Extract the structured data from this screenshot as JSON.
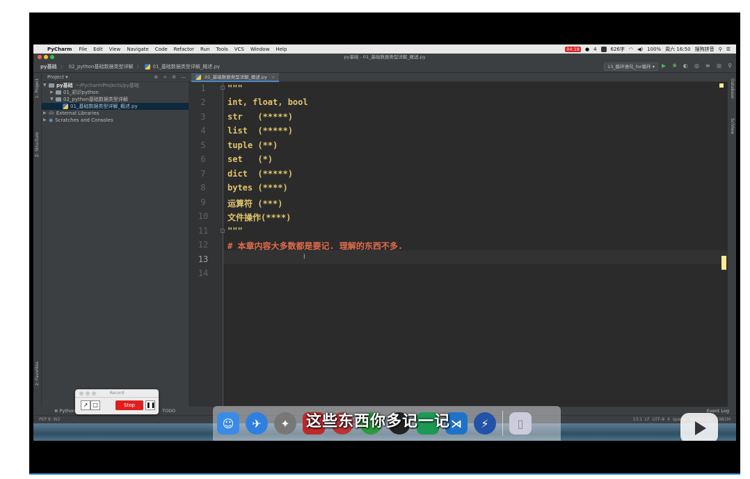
{
  "menubar": {
    "app_name": "PyCharm",
    "items": [
      "File",
      "Edit",
      "View",
      "Navigate",
      "Code",
      "Refactor",
      "Run",
      "Tools",
      "VCS",
      "Window",
      "Help"
    ],
    "rec_time": "04:18",
    "wechat_count": "4",
    "memory": "626字",
    "battery": "100%",
    "clock": "周六 16:50",
    "input_method": "搜狗拼音"
  },
  "window_title": "py基础 - 01_基础数据类型详解_概述.py",
  "navbar": {
    "crumbs": [
      "py基础",
      "02_python基础数据类型详解",
      "01_基础数据类型详解_概述.py"
    ],
    "run_config": "13_循环语句_for循环"
  },
  "left_strip": {
    "project_label": "1: Project",
    "structure_label": "Z: Structure",
    "favorites_label": "2: Favorites"
  },
  "project": {
    "header": "Project",
    "tree": [
      {
        "label": "py基础",
        "extra": "~/PycharmProjects/py基础",
        "indent": 0,
        "arrow": "▼",
        "type": "folder"
      },
      {
        "label": "01_初识python",
        "extra": "",
        "indent": 1,
        "arrow": "▶",
        "type": "folder"
      },
      {
        "label": "02_python基础数据类型详解",
        "extra": "",
        "indent": 1,
        "arrow": "▼",
        "type": "folder"
      },
      {
        "label": "01_基础数据类型详解_概述.py",
        "extra": "",
        "indent": 2,
        "arrow": "",
        "type": "py"
      },
      {
        "label": "External Libraries",
        "extra": "",
        "indent": 0,
        "arrow": "▶",
        "type": "lib"
      },
      {
        "label": "Scratches and Consoles",
        "extra": "",
        "indent": 0,
        "arrow": "▶",
        "type": "scratch"
      }
    ]
  },
  "editor": {
    "tab_label": "01_基础数据类型详解_概述.py",
    "lines": [
      {
        "num": "1",
        "text": "\"\"\"",
        "kind": "string"
      },
      {
        "num": "2",
        "text": "int, float, bool",
        "kind": "string"
      },
      {
        "num": "3",
        "text": "str   (*****)",
        "kind": "string"
      },
      {
        "num": "4",
        "text": "list  (*****)",
        "kind": "string"
      },
      {
        "num": "5",
        "text": "tuple (**)",
        "kind": "string"
      },
      {
        "num": "6",
        "text": "set   (*)",
        "kind": "string"
      },
      {
        "num": "7",
        "text": "dict  (*****)",
        "kind": "string"
      },
      {
        "num": "8",
        "text": "bytes (****)",
        "kind": "string"
      },
      {
        "num": "9",
        "text": "运算符 (***)",
        "kind": "string"
      },
      {
        "num": "10",
        "text": "文件操作(****)",
        "kind": "string"
      },
      {
        "num": "11",
        "text": "\"\"\"",
        "kind": "string"
      },
      {
        "num": "12",
        "text": "# 本章内容大多数都是要记. 理解的东西不多.",
        "kind": "comment"
      },
      {
        "num": "13",
        "text": "",
        "kind": "current"
      },
      {
        "num": "14",
        "text": "",
        "kind": "string"
      }
    ],
    "caret_symbol": "I"
  },
  "right_strip": {
    "database_label": "Database",
    "sciview_label": "SciView"
  },
  "bottom_tools": {
    "python_console": "Python",
    "todo": "TODO",
    "event_log": "Event Log"
  },
  "statusbar": {
    "left": "PEP 8: W2",
    "right": "13:1  LF  UTF-8  4 spaces  Python 3.7",
    "memory": "1981M"
  },
  "record_widget": {
    "title": "Record",
    "stop_label": "Stop"
  },
  "subtitle": "这些东西你多记一记",
  "colors": {
    "string": "#e0c46c",
    "comment": "#e06c4b",
    "editor_bg": "#2b2b2b"
  }
}
